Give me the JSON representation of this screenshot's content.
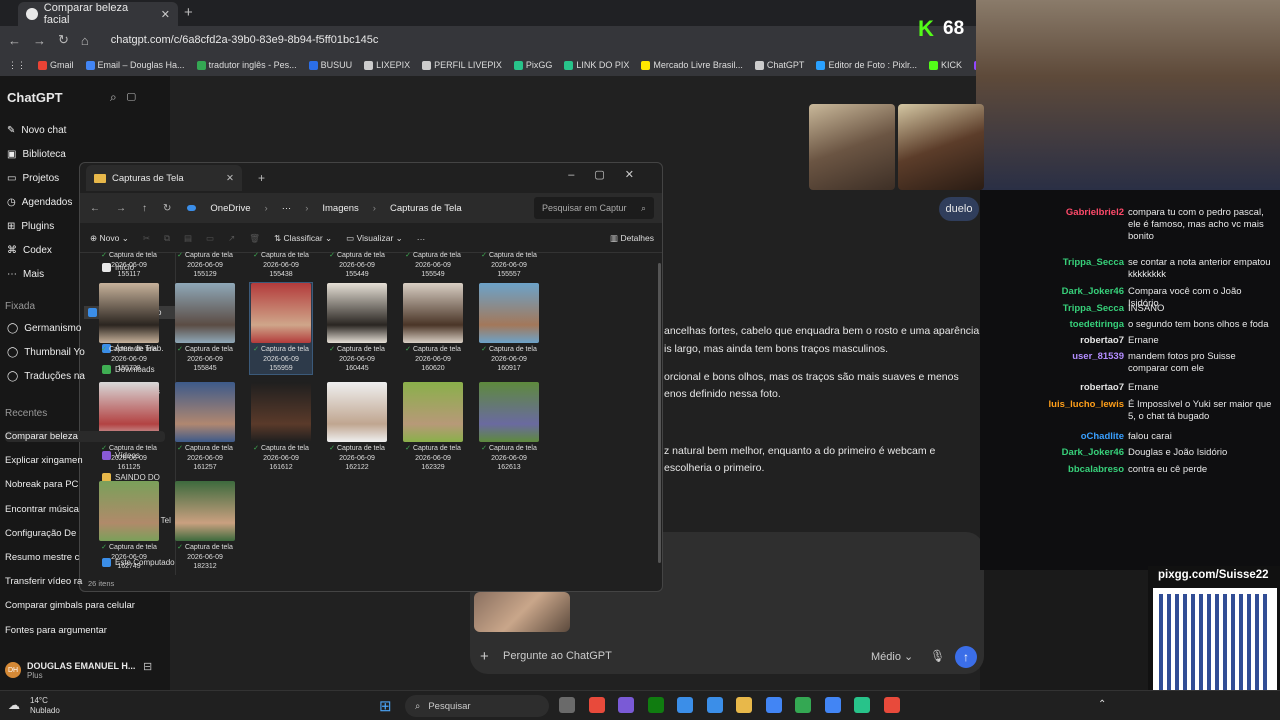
{
  "browser": {
    "tab_title": "Comparar beleza facial",
    "url": "chatgpt.com/c/6a8cfd2a-39b0-83e9-8b94-f5ff01bc145c",
    "bookmarks": [
      {
        "label": "Gmail",
        "color": "#ea4335"
      },
      {
        "label": "Email – Douglas Ha...",
        "color": "#4285f4"
      },
      {
        "label": "tradutor inglês - Pes...",
        "color": "#34a853"
      },
      {
        "label": "BUSUU",
        "color": "#2b6ee8"
      },
      {
        "label": "LIXEPIX",
        "color": "#cccccc"
      },
      {
        "label": "PERFIL LIVEPIX",
        "color": "#cccccc"
      },
      {
        "label": "PixGG",
        "color": "#28c38a"
      },
      {
        "label": "LINK DO PIX",
        "color": "#28c38a"
      },
      {
        "label": "Mercado Livre Brasil...",
        "color": "#ffe600"
      },
      {
        "label": "ChatGPT",
        "color": "#cccccc"
      },
      {
        "label": "Editor de Foto : Pixlr...",
        "color": "#2aa1ff"
      },
      {
        "label": "KICK",
        "color": "#53fc18"
      },
      {
        "label": "TWITCH",
        "color": "#9146ff"
      },
      {
        "label": "botri",
        "color": "#cccccc"
      }
    ]
  },
  "sidebar": {
    "title": "ChatGPT",
    "items": [
      "Novo chat",
      "Biblioteca",
      "Projetos",
      "Agendados",
      "Plugins",
      "Codex",
      "Mais"
    ],
    "pinned_label": "Fixada",
    "pinned": [
      "Germanismo",
      "Thumbnail Yo",
      "Traduções na"
    ],
    "recent_label": "Recentes",
    "recent": [
      "Comparar beleza",
      "Explicar xingamen",
      "Nobreak para PC",
      "Encontrar música",
      "Configuração De",
      "Resumo mestre c",
      "Transferir vídeo ra",
      "Comparar gimbals para celular",
      "Fontes para argumentar"
    ],
    "user_initials": "DH",
    "user_name": "DOUGLAS EMANUEL H...",
    "user_plan": "Plus"
  },
  "chat": {
    "bubble": "duelo",
    "lines": [
      "ancelhas fortes, cabelo que enquadra bem o rosto e uma aparência",
      "is largo, mas ainda tem bons traços masculinos.",
      "orcional e bons olhos, mas os traços são mais suaves e menos",
      "enos definido nessa foto.",
      "z natural bem melhor, enquanto a do primeiro é webcam e",
      "escolheria o primeiro."
    ],
    "placeholder": "Pergunte ao ChatGPT",
    "model": "Médio"
  },
  "explorer": {
    "tab_title": "Capturas de Tela",
    "crumbs": [
      "OneDrive",
      "···",
      "Imagens",
      "Capturas de Tela"
    ],
    "search_placeholder": "Pesquisar em Captur",
    "cmd": {
      "new": "Novo",
      "sort": "Classificar",
      "view": "Visualizar",
      "more": "···",
      "details": "Detalhes"
    },
    "nav": [
      "Início",
      "Galeria",
      "Douglas – Pesso",
      "Área de Trab.",
      "Downloads",
      "Documentos",
      "Imagens",
      "Músicas",
      "Vídeos",
      "SAINDO DO",
      "Celular",
      "Capturas de Tel",
      "Este Computado"
    ],
    "status": "26 itens",
    "file_label": "Captura de tela",
    "top_row": [
      {
        "date": "2026-06-09",
        "time": "155117"
      },
      {
        "date": "2026-06-09",
        "time": "155129"
      },
      {
        "date": "2026-06-09",
        "time": "155438"
      },
      {
        "date": "2026-06-09",
        "time": "155449"
      },
      {
        "date": "2026-06-09",
        "time": "155549"
      },
      {
        "date": "2026-06-09",
        "time": "155557"
      }
    ],
    "files": [
      {
        "date": "2026-06-09",
        "time": "155728",
        "colors": [
          "#c7b29b",
          "#2b2520"
        ]
      },
      {
        "date": "2026-06-09",
        "time": "155845",
        "colors": [
          "#8fa8b8",
          "#5b4c44"
        ]
      },
      {
        "date": "2026-06-09",
        "time": "155959",
        "colors": [
          "#b33b3b",
          "#cfa68a"
        ]
      },
      {
        "date": "2026-06-09",
        "time": "160445",
        "colors": [
          "#e6e0d6",
          "#2a2622"
        ]
      },
      {
        "date": "2026-06-09",
        "time": "160620",
        "colors": [
          "#d9cfc4",
          "#4a3527"
        ]
      },
      {
        "date": "2026-06-09",
        "time": "160917",
        "colors": [
          "#6ca3c9",
          "#a3785a"
        ]
      },
      {
        "date": "2026-06-09",
        "time": "161125",
        "colors": [
          "#d8d8d8",
          "#b34242"
        ]
      },
      {
        "date": "2026-06-09",
        "time": "161257",
        "colors": [
          "#3d5a8a",
          "#b08770"
        ]
      },
      {
        "date": "2026-06-09",
        "time": "161612",
        "colors": [
          "#1f1f1f",
          "#5a3a2a"
        ]
      },
      {
        "date": "2026-06-09",
        "time": "162122",
        "colors": [
          "#efefef",
          "#c0a690"
        ]
      },
      {
        "date": "2026-06-09",
        "time": "162329",
        "colors": [
          "#8ab04a",
          "#b79978"
        ]
      },
      {
        "date": "2026-06-09",
        "time": "162613",
        "colors": [
          "#5e8a3d",
          "#6a6aa0"
        ]
      },
      {
        "date": "2026-06-09",
        "time": "162749",
        "colors": [
          "#7aa05a",
          "#b08a6a"
        ]
      },
      {
        "date": "2026-06-09",
        "time": "182312",
        "colors": [
          "#3d6a3d",
          "#caa080"
        ]
      }
    ]
  },
  "stream": {
    "kick_count": "68",
    "pix_url": "pixgg.com/Suisse22",
    "messages": [
      {
        "user": "Gabrielbriel2",
        "color": "#ff4a6a",
        "text": "compara tu com o pedro pascal, ele é famoso, mas acho vc mais bonito"
      },
      {
        "user": "Trippa_Secca",
        "color": "#37d07a",
        "text": "se contar a nota anterior empatou kkkkkkkk"
      },
      {
        "user": "Dark_Joker46",
        "color": "#37d07a",
        "text": "Compara você com o João Isidório"
      },
      {
        "user": "Trippa_Secca",
        "color": "#37d07a",
        "text": "INSANO"
      },
      {
        "user": "toedetiringa",
        "color": "#37d07a",
        "text": "o segundo tem bons olhos e foda"
      },
      {
        "user": "robertao7",
        "color": "#e5e5e5",
        "text": "Ernane"
      },
      {
        "user": "user_81539",
        "color": "#b38dff",
        "text": "mandem fotos pro Suisse comparar com ele"
      },
      {
        "user": "robertao7",
        "color": "#e5e5e5",
        "text": "Ernane"
      },
      {
        "user": "luis_lucho_lewis",
        "color": "#ff9f1a",
        "text": "É Impossível o Yuki ser maior que 5, o chat tá bugado"
      },
      {
        "user": "oChadlite",
        "color": "#3aa0ff",
        "text": "falou carai"
      },
      {
        "user": "Dark_Joker46",
        "color": "#37d07a",
        "text": "Douglas e João Isidório"
      },
      {
        "user": "bbcalabreso",
        "color": "#37d07a",
        "text": "contra eu cê perde"
      }
    ]
  },
  "taskbar": {
    "temp": "14°C",
    "condition": "Nublado",
    "search": "Pesquisar"
  }
}
